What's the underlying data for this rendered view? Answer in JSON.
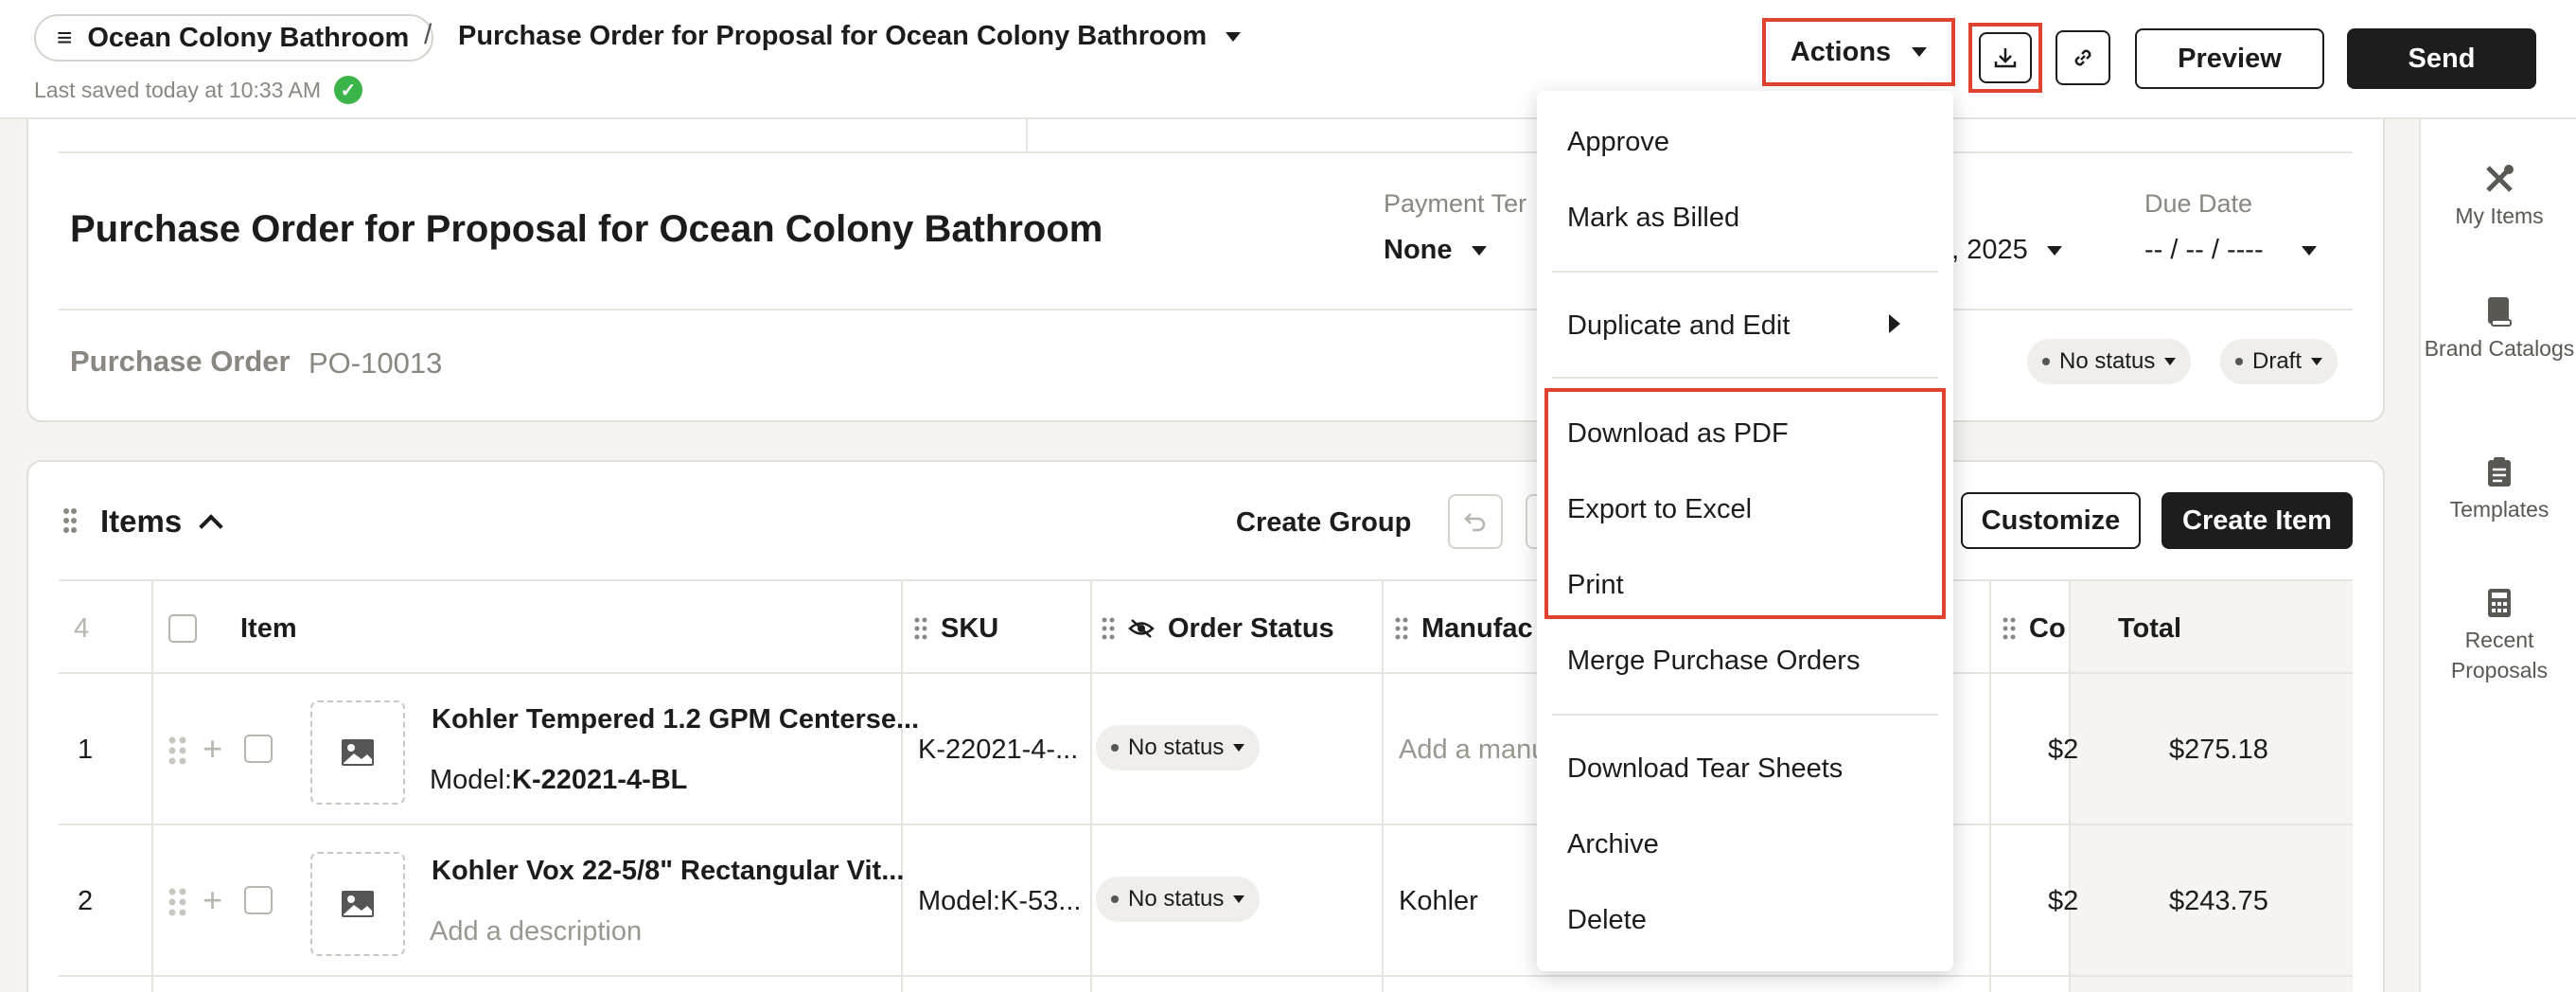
{
  "header": {
    "breadcrumb_project": "Ocean Colony Bathroom",
    "breadcrumb_sep": "/",
    "doc_name": "Purchase Order for Proposal for Ocean Colony Bathroom",
    "saved_status": "Last saved today at 10:33 AM",
    "actions_label": "Actions",
    "preview_label": "Preview",
    "send_label": "Send"
  },
  "sidebar": {
    "items": [
      {
        "label": "My Items",
        "icon": "tools-icon"
      },
      {
        "label": "Brand Catalogs",
        "icon": "book-icon"
      },
      {
        "label": "Templates",
        "icon": "clipboard-icon"
      },
      {
        "label": "Recent Proposals",
        "icon": "calculator-icon"
      }
    ]
  },
  "document": {
    "title": "Purchase Order for Proposal for Ocean Colony Bathroom",
    "payment_terms_label": "Payment Ter",
    "payment_terms_value": "None",
    "date_value": "0, 2025",
    "due_date_label": "Due Date",
    "due_date_value": "-- / -- / ----",
    "po_label": "Purchase Order",
    "po_number": "PO-10013",
    "status_pill": "No status",
    "draft_pill": "Draft"
  },
  "items": {
    "title": "Items",
    "create_group": "Create Group",
    "customize": "Customize",
    "create_item": "Create Item",
    "count": "4",
    "columns": [
      "Item",
      "SKU",
      "Order Status",
      "Manufac",
      "Co",
      "Total"
    ],
    "rows": [
      {
        "index": "1",
        "name": "Kohler Tempered 1.2 GPM Centerse...",
        "model_prefix": "Model:",
        "model": "K-22021-4-BL",
        "sku": "K-22021-4-...",
        "status": "No status",
        "manufacturer": "Add a manu",
        "cost": "$2",
        "total": "$275.18"
      },
      {
        "index": "2",
        "name": "Kohler Vox 22-5/8\" Rectangular Vit...",
        "description": "Add a description",
        "sku": "Model:K-53...",
        "status": "No status",
        "manufacturer": "Kohler",
        "cost": "$2",
        "total": "$243.75"
      }
    ]
  },
  "menu": {
    "items": {
      "approve": "Approve",
      "mark_billed": "Mark as Billed",
      "duplicate_edit": "Duplicate and Edit",
      "download_pdf": "Download as PDF",
      "export_excel": "Export to Excel",
      "print": "Print",
      "merge": "Merge Purchase Orders",
      "tear_sheets": "Download Tear Sheets",
      "archive": "Archive",
      "delete": "Delete"
    }
  },
  "colors": {
    "highlight": "#e0432f",
    "saved_check": "#3bb54a",
    "primary_button": "#1d1d1d"
  }
}
